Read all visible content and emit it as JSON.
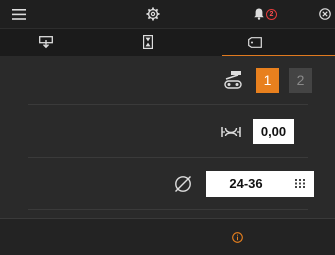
{
  "topbar": {
    "menu_icon": "hamburger-icon",
    "settings_icon": "gear-icon",
    "notifications_icon": "bell-icon",
    "notification_count": "2",
    "close_icon": "close-circle-icon"
  },
  "tabs": [
    {
      "icon": "download-tray-icon",
      "active": false
    },
    {
      "icon": "hourglass-icon",
      "active": false
    },
    {
      "icon": "tag-icon",
      "active": true
    }
  ],
  "rows": {
    "mode": {
      "icon": "feeder-icon",
      "options": [
        "1",
        "2"
      ],
      "selected": "1"
    },
    "offset": {
      "icon": "nip-icon",
      "value": "0,00"
    },
    "diameter": {
      "icon": "diameter-icon",
      "value": "24-36",
      "trailing_icon": "grid-icon"
    }
  },
  "footer": {
    "icon": "info-icon"
  },
  "colors": {
    "accent": "#e8801e",
    "badge": "#e43b3b",
    "background": "#1f1f1f",
    "panel": "#2a2a2a"
  }
}
